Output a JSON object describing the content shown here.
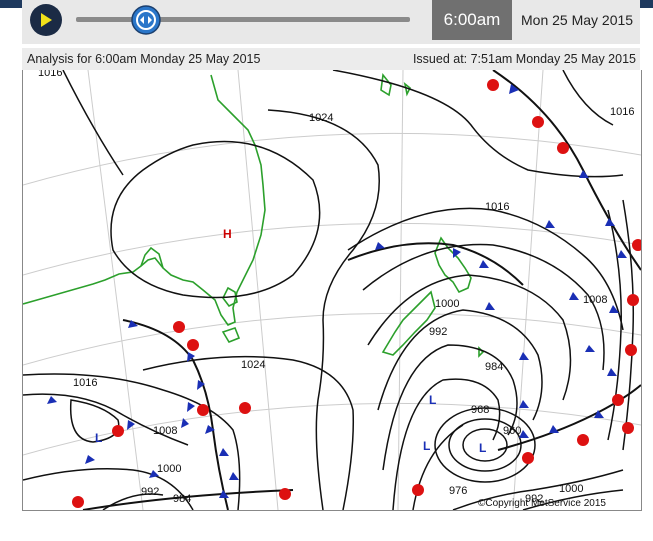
{
  "player": {
    "play_icon": "play-icon",
    "slider_fraction": 0.18,
    "time": "6:00am",
    "date": "Mon 25 May 2015"
  },
  "info": {
    "analysis": "Analysis for 6:00am Monday 25 May 2015",
    "issued": "Issued at: 7:51am Monday 25 May 2015"
  },
  "map": {
    "pressure_labels": [
      "1016",
      "1024",
      "1016",
      "1016",
      "1008",
      "1000",
      "992",
      "984",
      "968",
      "960",
      "976",
      "992",
      "1000",
      "1024",
      "1016",
      "1008",
      "1000",
      "992",
      "984"
    ],
    "high_label": "H",
    "low_label": "L",
    "copyright": "©Copyright MetService 2015",
    "colors": {
      "isobar": "#111111",
      "coast": "#2ca02c",
      "high": "#cc0000",
      "low": "#1a2fb5",
      "warm_front": "#dd1111",
      "cold_front": "#1a2fb5"
    }
  }
}
